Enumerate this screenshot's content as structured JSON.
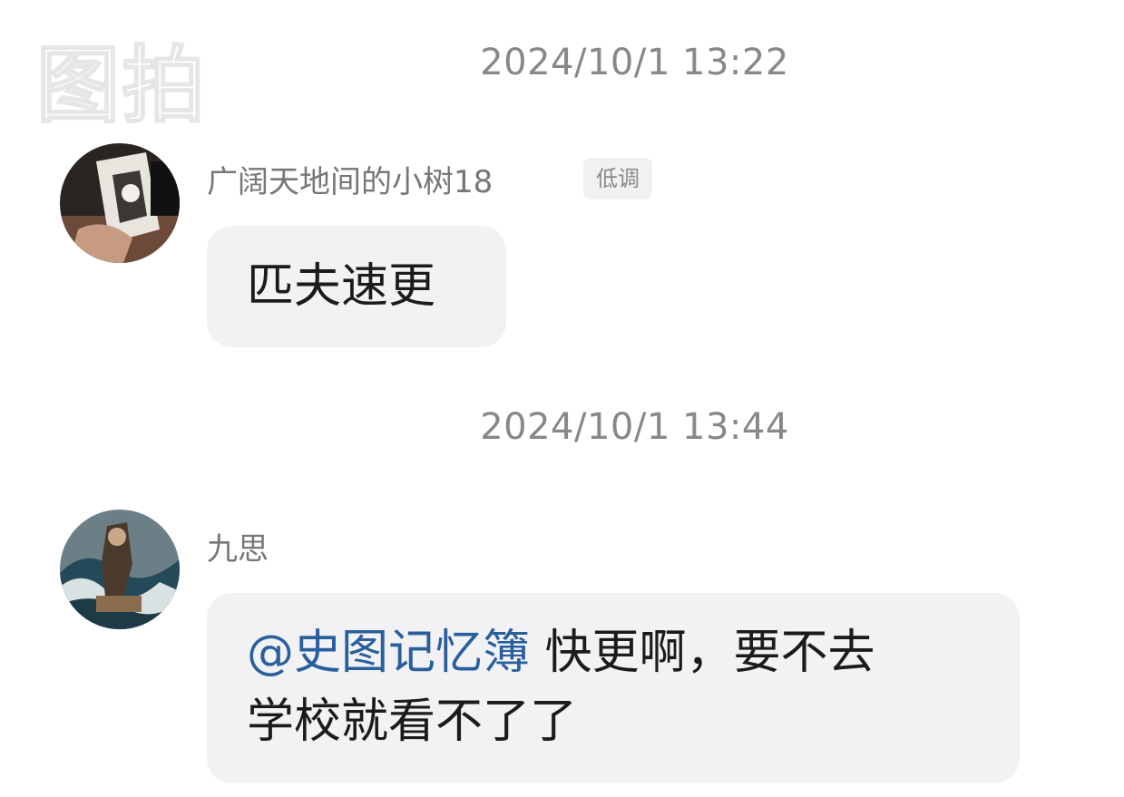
{
  "watermark": "图拍",
  "messages": [
    {
      "timestamp": "2024/10/1 13:22",
      "username": "广阔天地间的小树18",
      "badge": "低调",
      "text": "匹夫速更"
    },
    {
      "timestamp": "2024/10/1 13:44",
      "username": "九思",
      "mention": "@史图记忆簿",
      "text_line1": " 快更啊，要不去",
      "text_line2": "学校就看不了了"
    }
  ],
  "colors": {
    "background": "#ffffff",
    "bubble": "#f2f2f5",
    "mention": "#2a5f9e",
    "timestamp": "#888888",
    "username": "#777777"
  },
  "icons": {
    "avatar_1": "avatar-photo-hand-with-card",
    "avatar_2": "avatar-photo-ocean-wave-figure"
  }
}
